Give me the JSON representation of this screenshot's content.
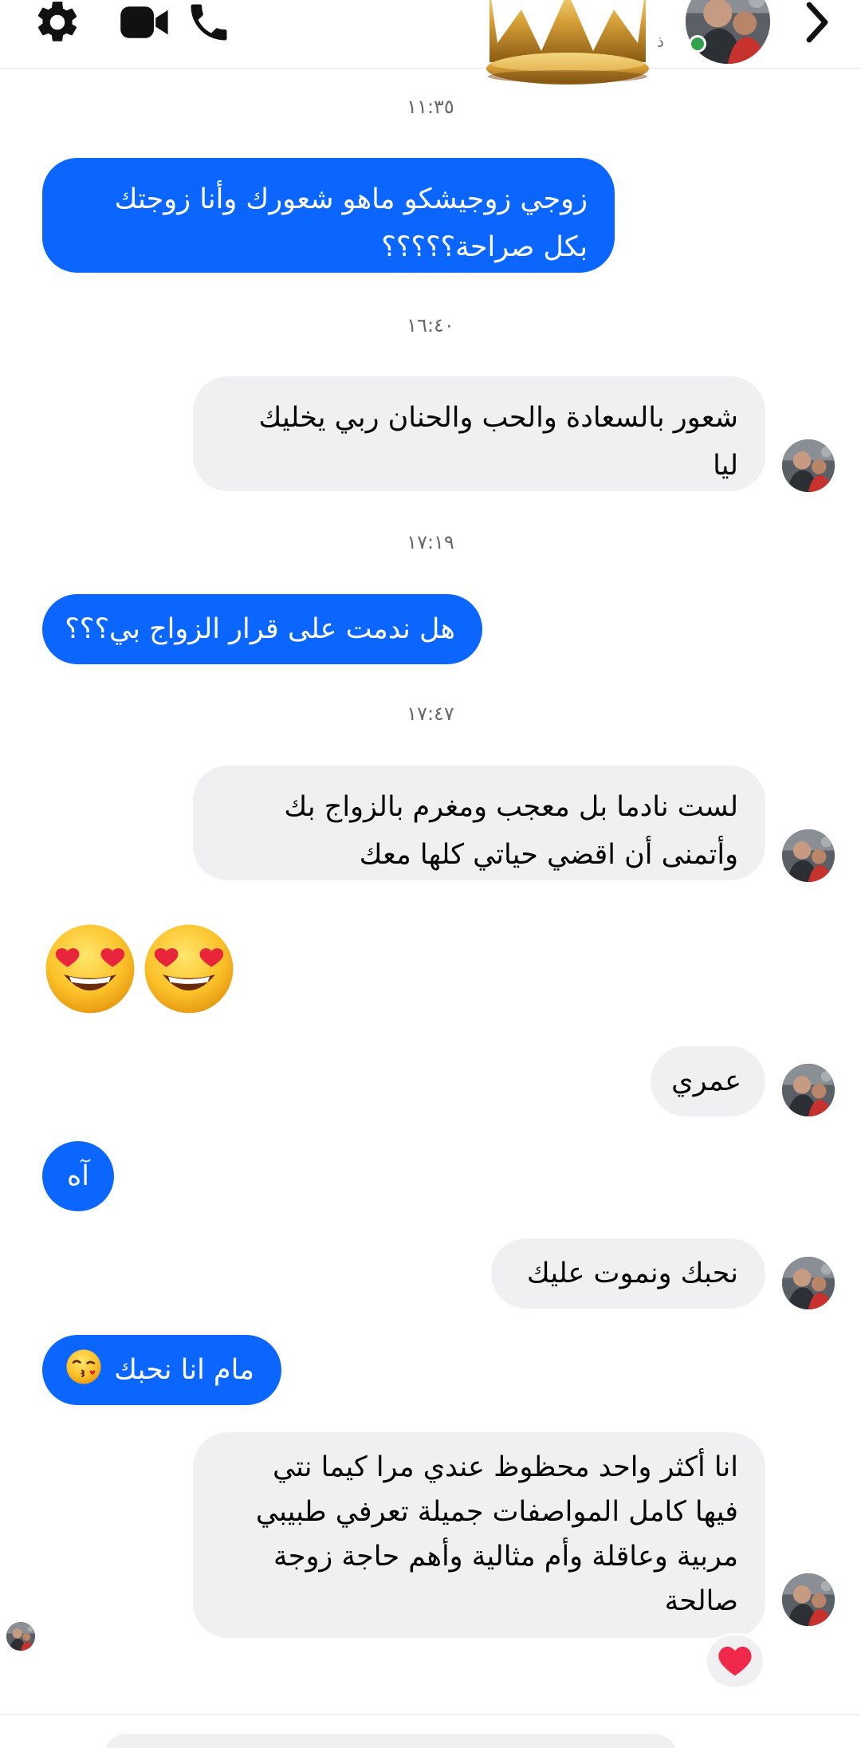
{
  "header": {
    "icons": {
      "settings": "gear-icon",
      "video": "video-camera-icon",
      "call": "phone-icon",
      "back": "chevron-right-icon",
      "sticker": "crown-sticker"
    },
    "name_fragment": "ذ",
    "online_color": "#31a24c"
  },
  "colors": {
    "outgoing": "#0a66ff",
    "incoming": "#f0f0f2",
    "timestamp": "#65676b"
  },
  "messages": [
    {
      "type": "time",
      "text": "١١:٣٥"
    },
    {
      "type": "outgoing",
      "lines": [
        "زوجي زوجيشكو ماهو شعورك وأنا زوجتك",
        "بكل صراحة؟؟؟؟؟"
      ]
    },
    {
      "type": "time",
      "text": "١٦:٤٠"
    },
    {
      "type": "incoming",
      "lines": [
        "شعور بالسعادة والحب والحنان ربي يخليك",
        "ليا"
      ]
    },
    {
      "type": "time",
      "text": "١٧:١٩"
    },
    {
      "type": "outgoing",
      "lines": [
        "هل ندمت على قرار الزواج بي؟؟؟"
      ]
    },
    {
      "type": "time",
      "text": "١٧:٤٧"
    },
    {
      "type": "incoming",
      "lines": [
        "لست نادما بل معجب ومغرم بالزواج بك",
        "وأتمنى أن اقضي حياتي كلها معك"
      ]
    },
    {
      "type": "outgoing-emoji",
      "emoji": "heart-eyes-emoji",
      "count": 2
    },
    {
      "type": "incoming",
      "lines": [
        "عمري"
      ]
    },
    {
      "type": "outgoing",
      "lines": [
        "آه"
      ]
    },
    {
      "type": "incoming",
      "lines": [
        "نحبك ونموت عليك"
      ]
    },
    {
      "type": "outgoing",
      "lines": [
        "مام انا نحبك"
      ],
      "emoji": "kissing-face-emoji"
    },
    {
      "type": "incoming",
      "lines": [
        "انا أكثر واحد محظوظ عندي مرا كيما نتي",
        "فيها كامل المواصفات جميلة تعرفي طبيبي",
        "مربية وعاقلة وأم مثالية وأهم حاجة زوجة",
        "صالحة"
      ],
      "reaction": "red-heart-icon",
      "seen_by": "seen-avatar"
    }
  ]
}
